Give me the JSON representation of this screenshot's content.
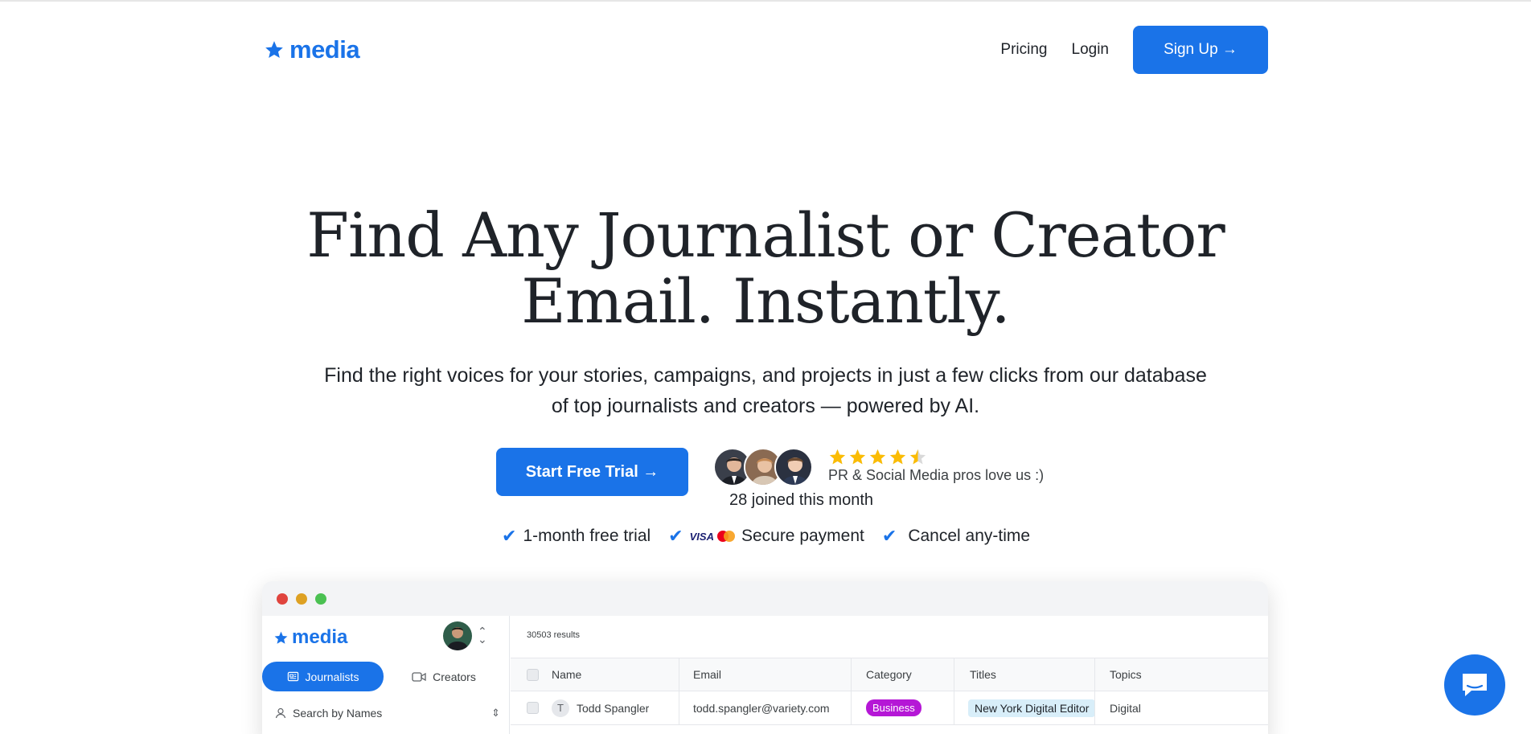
{
  "nav": {
    "logo_text": "media",
    "pricing": "Pricing",
    "login": "Login",
    "signup": "Sign Up →"
  },
  "hero": {
    "title_line1": "Find Any Journalist or Creator",
    "title_line2": "Email. Instantly.",
    "subtitle_line1": "Find the right voices for your stories, campaigns, and projects in just a few clicks from our database",
    "subtitle_line2": "of top journalists and creators — powered by AI.",
    "cta": "Start Free Trial →",
    "rating": 4.5,
    "rating_max": 5,
    "love": "PR & Social Media pros love us :)",
    "joined": "28 joined this month"
  },
  "checks": {
    "trial": "1-month free trial",
    "visa": "VISA",
    "secure": "Secure payment",
    "cancel": "Cancel any-time"
  },
  "app": {
    "logo_text": "media",
    "results": "30503 results",
    "tab_journalists": "Journalists",
    "tab_creators": "Creators",
    "search_label": "Search by Names",
    "columns": {
      "name": "Name",
      "email": "Email",
      "category": "Category",
      "titles": "Titles",
      "topics": "Topics"
    },
    "row": {
      "initial": "T",
      "name": "Todd Spangler",
      "email": "todd.spangler@variety.com",
      "category": "Business",
      "title": "New York Digital Editor",
      "topics": "Digital"
    }
  },
  "colors": {
    "brand": "#1a73e8",
    "star": "#fbbc04",
    "business_badge": "#b517d6",
    "title_badge": "#d8eef9"
  },
  "icons": [
    "star-logo-icon",
    "arrow-right-icon",
    "star-icon",
    "check-icon",
    "newspaper-icon",
    "video-icon",
    "person-icon",
    "chevron-updown-icon",
    "chat-icon"
  ]
}
